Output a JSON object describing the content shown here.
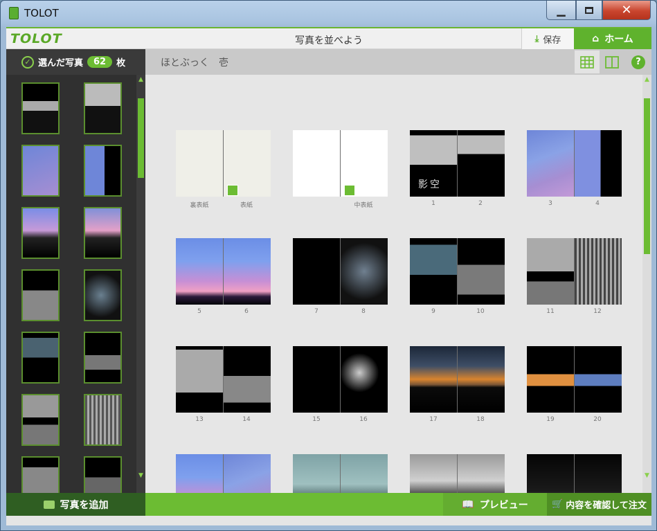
{
  "window": {
    "title": "TOLOT"
  },
  "header": {
    "logo": "TOLOT",
    "title": "写真を並べよう",
    "save_label": "保存",
    "home_label": "ホーム"
  },
  "selection": {
    "prefix": "選んだ写真",
    "count": "62",
    "suffix": "枚"
  },
  "album": {
    "name": "ほとぶっく　壱"
  },
  "spreads": [
    {
      "labels": [
        "裏表紙",
        "表紙"
      ]
    },
    {
      "labels": [
        "",
        "中表紙"
      ]
    },
    {
      "labels": [
        "1",
        "2"
      ]
    },
    {
      "labels": [
        "3",
        "4"
      ]
    },
    {
      "labels": [
        "5",
        "6"
      ]
    },
    {
      "labels": [
        "7",
        "8"
      ]
    },
    {
      "labels": [
        "9",
        "10"
      ]
    },
    {
      "labels": [
        "11",
        "12"
      ]
    },
    {
      "labels": [
        "13",
        "14"
      ]
    },
    {
      "labels": [
        "15",
        "16"
      ]
    },
    {
      "labels": [
        "17",
        "18"
      ]
    },
    {
      "labels": [
        "19",
        "20"
      ]
    },
    {
      "labels": [
        "",
        ""
      ]
    },
    {
      "labels": [
        "",
        ""
      ]
    },
    {
      "labels": [
        "",
        ""
      ]
    },
    {
      "labels": [
        "",
        ""
      ]
    }
  ],
  "cover_text": {
    "title": "影空",
    "logo_small": "TOLOT"
  },
  "bottom": {
    "add_label": "写真を追加",
    "preview_label": "プレビュー",
    "order_label": "内容を確認して注文"
  },
  "colors": {
    "accent": "#6cbc33",
    "dark_green": "#2f5e22",
    "panel": "#303030"
  }
}
